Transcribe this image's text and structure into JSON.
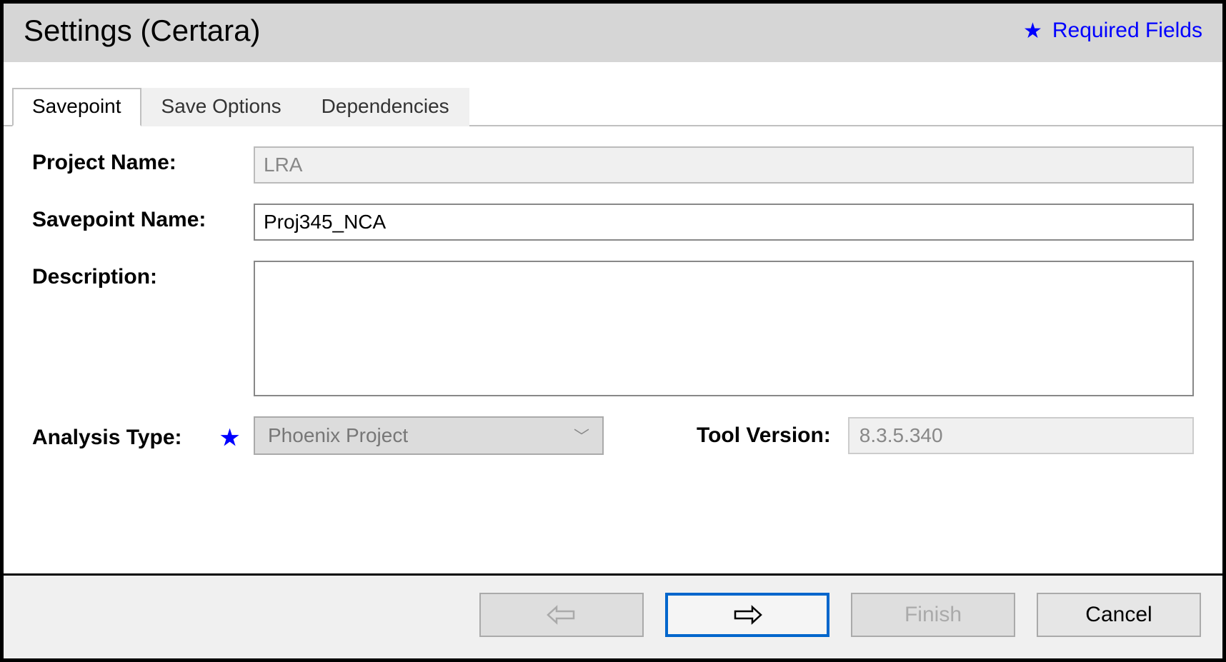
{
  "title": "Settings (Certara)",
  "required_note": "Required Fields",
  "tabs": [
    "Savepoint",
    "Save Options",
    "Dependencies"
  ],
  "active_tab_index": 0,
  "form": {
    "project_name_label": "Project Name:",
    "project_name_value": "LRA",
    "savepoint_name_label": "Savepoint Name:",
    "savepoint_name_value": "Proj345_NCA",
    "description_label": "Description:",
    "description_value": "",
    "analysis_type_label": "Analysis Type:",
    "analysis_type_value": "Phoenix Project",
    "tool_version_label": "Tool Version:",
    "tool_version_value": "8.3.5.340"
  },
  "buttons": {
    "back": "Back",
    "next": "Next",
    "finish": "Finish",
    "cancel": "Cancel"
  }
}
